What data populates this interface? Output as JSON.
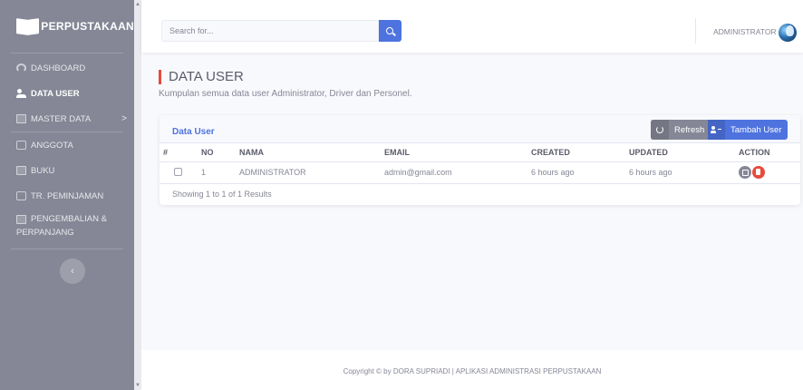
{
  "brand": {
    "name": "PERPUSTAKAAN",
    "icon": "book-open-icon"
  },
  "sidebar": {
    "items": [
      {
        "label": "DASHBOARD",
        "icon": "dashboard-icon"
      },
      {
        "label": "DATA USER",
        "icon": "users-icon",
        "active": true
      },
      {
        "label": "MASTER DATA",
        "icon": "box-icon",
        "chevron": ">"
      },
      {
        "label": "ANGGOTA",
        "icon": "id-card-icon"
      },
      {
        "label": "BUKU",
        "icon": "book-icon"
      },
      {
        "label": "TR. PEMINJAMAN",
        "icon": "exchange-icon"
      },
      {
        "label": "PENGEMBALIAN &",
        "label2": "PERPANJANG",
        "icon": "return-icon"
      }
    ],
    "toggle": "‹"
  },
  "topbar": {
    "search": {
      "placeholder": "Search for..."
    },
    "user": {
      "name": "ADMINISTRATOR"
    }
  },
  "page": {
    "title": "DATA USER",
    "subtitle": "Kumpulan semua data user Administrator, Driver dan Personel."
  },
  "card": {
    "title": "Data User",
    "refresh_label": "Refresh",
    "add_label": "Tambah User"
  },
  "table": {
    "headers": {
      "hash": "#",
      "no": "NO",
      "nama": "NAMA",
      "email": "EMAIL",
      "created": "CREATED",
      "updated": "UPDATED",
      "action": "ACTION"
    },
    "rows": [
      {
        "no": "1",
        "nama": "ADMINISTRATOR",
        "email": "admin@gmail.com",
        "created": "6 hours ago",
        "updated": "6 hours ago"
      }
    ],
    "summary": "Showing 1 to 1 of 1 Results"
  },
  "footer": {
    "text": "Copyright © by DORA SUPRIADI | APLIKASI ADMINISTRASI PERPUSTAKAAN"
  },
  "colors": {
    "sidebar": "#858796",
    "primary": "#4e73df",
    "danger": "#e74a3b",
    "secondary": "#858796"
  }
}
